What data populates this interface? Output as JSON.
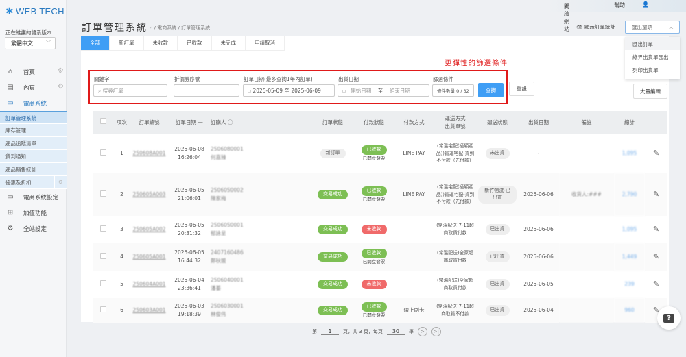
{
  "brand": {
    "name": "WEB TECH"
  },
  "sidebar": {
    "lang_label": "正在維護的語系版本",
    "lang_value": "繁體中文",
    "items": [
      {
        "label": "首頁",
        "icon": "home-icon"
      },
      {
        "label": "內頁",
        "icon": "document-icon"
      },
      {
        "label": "電商系統",
        "icon": "cart-icon"
      }
    ],
    "sub_items": [
      "訂單管理系統",
      "庫存管理",
      "產品追蹤清單",
      "貨到通知",
      "產品銷售統計",
      "優惠及折扣"
    ],
    "bottom_items": [
      {
        "label": "電商系統設定",
        "icon": "cart-icon"
      },
      {
        "label": "加值功能",
        "icon": "gift-icon"
      },
      {
        "label": "全站設定",
        "icon": "gear-icon"
      }
    ]
  },
  "topbar": {
    "open_site": "開啟網站",
    "help": "幫助"
  },
  "header": {
    "title": "訂單管理系統",
    "breadcrumb": "/ 電商系統 / 訂單管理系統",
    "show_stats": "顯示訂單統計",
    "export_placeholder": "匯出選項",
    "export_options": [
      "匯出訂單",
      "綠界出貨單匯出",
      "列印出貨單"
    ]
  },
  "tabs": [
    "全部",
    "新訂單",
    "未收款",
    "已收款",
    "未完成",
    "申請取消"
  ],
  "filter": {
    "hint": "更彈性的篩選條件",
    "keyword_label": "關鍵字",
    "keyword_placeholder": "搜尋訂單",
    "coupon_label": "折價券序號",
    "order_date_label": "訂單日期(最多查詢1年內訂單)",
    "order_date_from": "2025-05-09",
    "to": "至",
    "order_date_to": "2025-06-09",
    "ship_date_label": "出貨日期",
    "ship_start": "開始日期",
    "ship_end": "結束日期",
    "cond_label": "篩選條件",
    "cond_value": "條件數量 0 / 32",
    "query": "查詢",
    "reset": "重設",
    "bulk_edit": "大量編輯"
  },
  "table": {
    "headers": [
      "項次",
      "訂單編號",
      "訂單日期 —",
      "訂購人",
      "訂單狀態",
      "付款狀態",
      "付款方式",
      "運送方式\n出貨單號",
      "運送狀態",
      "出貨日期",
      "備註",
      "總計"
    ],
    "rows": [
      {
        "no": "1",
        "id": "250608A001",
        "date": "2025-06-08",
        "time": "16:26:04",
        "buyer_id": "2506080001",
        "buyer_name": "何嘉臻",
        "status": "新訂單",
        "status_color": "gray",
        "pay": "已收款",
        "pay_color": "green",
        "invoice": "已開立發票",
        "method": "LINE PAY",
        "shipping": "(常溫宅配(極穎產品))貨運宅配-貨到不付款（先付款）",
        "ship_status": "未出貨",
        "ship_date": "-",
        "note": "",
        "total": "1,095"
      },
      {
        "no": "2",
        "id": "250605A003",
        "date": "2025-06-05",
        "time": "21:06:01",
        "buyer_id": "2506050002",
        "buyer_name": "陳家梅",
        "status": "交易成功",
        "status_color": "green",
        "pay": "已收款",
        "pay_color": "green",
        "invoice": "已開立發票",
        "method": "LINE PAY",
        "shipping": "(常溫宅配(極穎產品))貨運宅配-貨到不付款（先付款）",
        "ship_status": "新竹物流-已出貨",
        "ship_date": "2025-06-06",
        "note": "收貨人:###",
        "total": "2,790"
      },
      {
        "no": "3",
        "id": "250605A002",
        "date": "2025-06-05",
        "time": "20:31:32",
        "buyer_id": "2506050001",
        "buyer_name": "郁詠呈",
        "status": "交易成功",
        "status_color": "green",
        "pay": "未收款",
        "pay_color": "red",
        "invoice": "",
        "method": "",
        "shipping": "(常溫配送)7-11超商取貨付款",
        "ship_status": "已出貨",
        "ship_date": "2025-06-06",
        "note": "",
        "total": "1,095"
      },
      {
        "no": "4",
        "id": "250605A001",
        "date": "2025-06-05",
        "time": "16:44:32",
        "buyer_id": "2407160486",
        "buyer_name": "鄭秋媛",
        "status": "交易成功",
        "status_color": "green",
        "pay": "已收款",
        "pay_color": "green",
        "invoice": "已開立發票",
        "method": "",
        "shipping": "(常溫配送)全家超商取貨付款",
        "ship_status": "已出貨",
        "ship_date": "2025-06-06",
        "note": "",
        "total": "1,449"
      },
      {
        "no": "5",
        "id": "250604A001",
        "date": "2025-06-04",
        "time": "23:36:41",
        "buyer_id": "2506040001",
        "buyer_name": "潘蓁",
        "status": "交易成功",
        "status_color": "green",
        "pay": "未收款",
        "pay_color": "red",
        "invoice": "",
        "method": "",
        "shipping": "(常溫配送)全家超商取貨付款",
        "ship_status": "已出貨",
        "ship_date": "2025-06-05",
        "note": "",
        "total": "239"
      },
      {
        "no": "6",
        "id": "250603A001",
        "date": "2025-06-03",
        "time": "19:18:39",
        "buyer_id": "2506030001",
        "buyer_name": "林俊伟",
        "status": "交易成功",
        "status_color": "green",
        "pay": "已收款",
        "pay_color": "green",
        "invoice": "已開立發票",
        "method": "線上刷卡",
        "shipping": "(常溫配送)7-11超商取貨不付款",
        "ship_status": "已出貨",
        "ship_date": "2025-06-04",
        "note": "",
        "total": "960"
      }
    ]
  },
  "pager": {
    "prefix": "第",
    "page": "1",
    "mid": "頁，共 3 頁，每頁",
    "per_page": "30",
    "suffix": "筆"
  },
  "help_label": "?"
}
